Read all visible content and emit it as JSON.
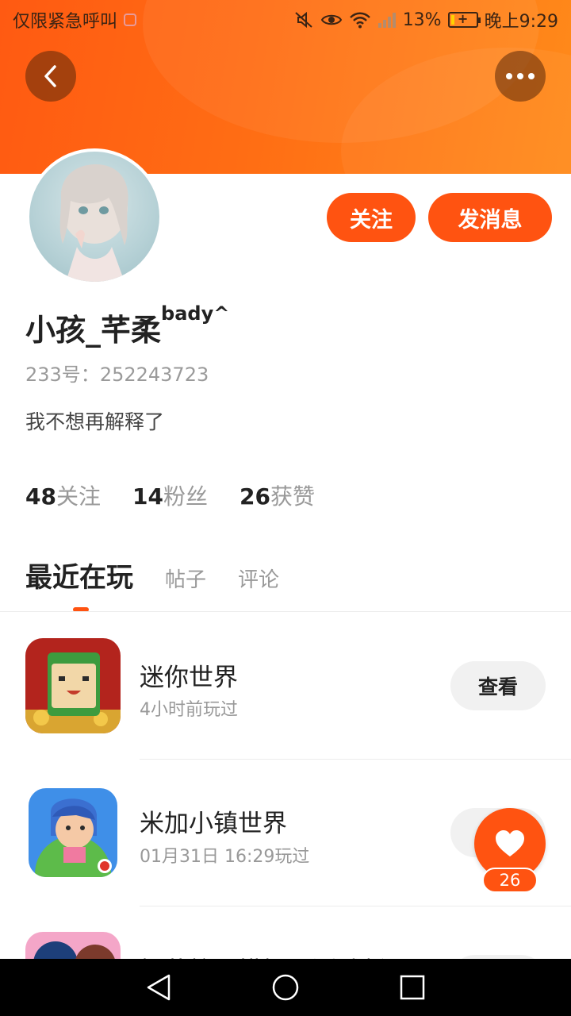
{
  "status_bar": {
    "carrier": "仅限紧急呼叫",
    "battery": "13%",
    "battery_level": 0.13,
    "time": "晚上9:29"
  },
  "profile": {
    "name": "小孩_芊柔",
    "name_suffix": "bady^",
    "uid_label": "233号：",
    "uid": "252243723",
    "bio": "我不想再解释了",
    "follow_label": "关注",
    "message_label": "发消息"
  },
  "stats": [
    {
      "num": "48",
      "label": "关注"
    },
    {
      "num": "14",
      "label": "粉丝"
    },
    {
      "num": "26",
      "label": "获赞"
    }
  ],
  "tabs": [
    {
      "label": "最近在玩"
    },
    {
      "label": "帖子"
    },
    {
      "label": "评论"
    }
  ],
  "games": [
    {
      "name": "迷你世界",
      "time": "4小时前玩过",
      "action": "查看"
    },
    {
      "name": "米加小镇世界",
      "time": "01月31日 16:29玩过",
      "action": "查看"
    },
    {
      "name": "樱花校园模拟器测试版",
      "time": "",
      "action": "查看"
    }
  ],
  "like_fab": {
    "count": "26"
  },
  "colors": {
    "accent": "#ff5311",
    "header_start": "#ff5a12",
    "header_end": "#ff8a1a"
  }
}
